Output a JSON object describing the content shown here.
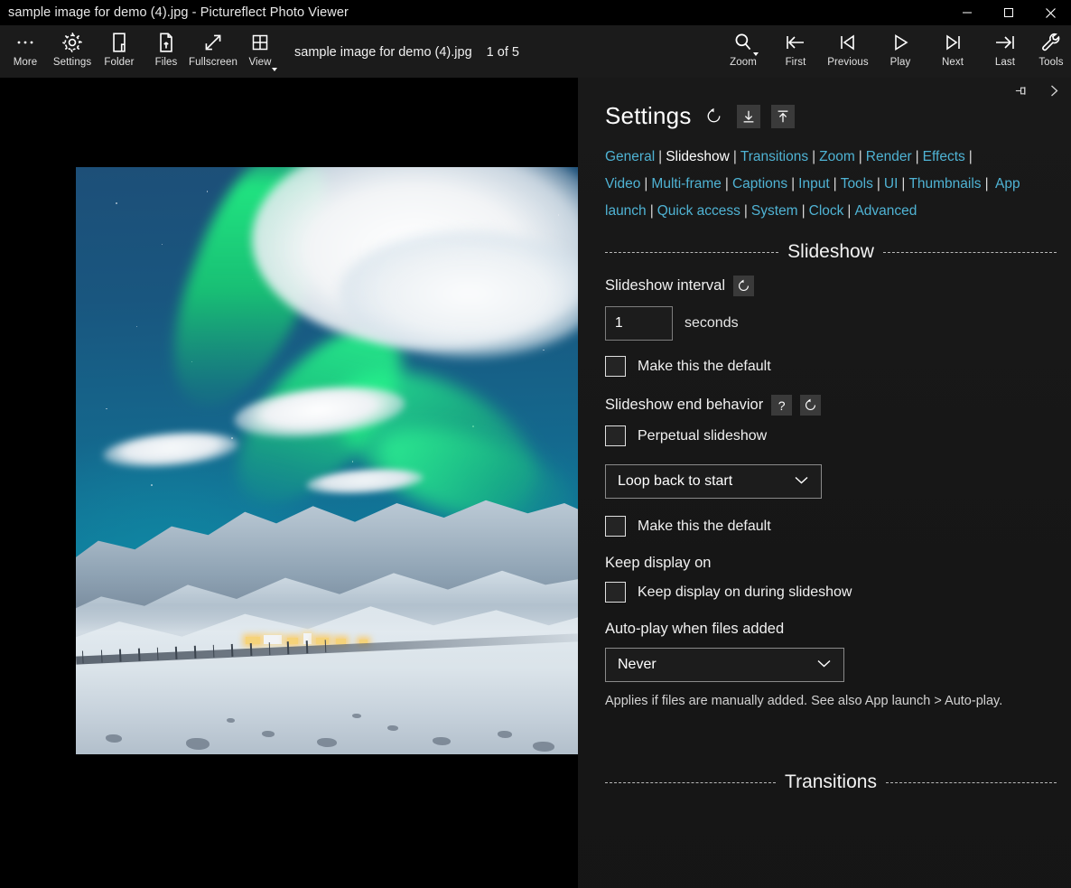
{
  "window": {
    "title": "sample image for demo (4).jpg - Pictureflect Photo Viewer",
    "controls": {
      "minimize": "minimize-icon",
      "maximize": "maximize-icon",
      "close": "close-icon"
    }
  },
  "toolbar": {
    "left_items": [
      {
        "label": "More",
        "icon": "ellipsis-icon",
        "caret": false
      },
      {
        "label": "Settings",
        "icon": "gear-icon",
        "caret": false
      },
      {
        "label": "Folder",
        "icon": "folder-icon",
        "caret": false
      },
      {
        "label": "Files",
        "icon": "files-icon",
        "caret": false
      },
      {
        "label": "Fullscreen",
        "icon": "fullscreen-icon",
        "caret": false
      },
      {
        "label": "View",
        "icon": "grid-view-icon",
        "caret": true
      }
    ],
    "filename": "sample image for demo (4).jpg",
    "counter": "1 of 5",
    "right_items": [
      {
        "label": "Zoom",
        "icon": "magnifier-icon",
        "caret": true
      },
      {
        "label": "First",
        "icon": "skip-first-icon",
        "caret": false
      },
      {
        "label": "Previous",
        "icon": "previous-icon",
        "caret": false
      },
      {
        "label": "Play",
        "icon": "play-icon",
        "caret": false
      },
      {
        "label": "Next",
        "icon": "next-icon",
        "caret": false
      },
      {
        "label": "Last",
        "icon": "skip-last-icon",
        "caret": false
      },
      {
        "label": "Tools",
        "icon": "wrench-icon",
        "caret": false
      }
    ]
  },
  "panel": {
    "top_buttons": [
      {
        "name": "pin-icon"
      },
      {
        "name": "chevron-right-icon"
      }
    ],
    "title": "Settings",
    "head_buttons": [
      {
        "name": "reset-icon",
        "glyph": "reset"
      },
      {
        "name": "import-icon",
        "glyph": "import"
      },
      {
        "name": "export-icon",
        "glyph": "export"
      }
    ],
    "nav_links": [
      "General",
      "Slideshow",
      "Transitions",
      "Zoom",
      "Render",
      "Effects",
      "Video",
      "Multi-frame",
      "Captions",
      "Input",
      "Tools",
      "UI",
      "Thumbnails",
      "App launch",
      "Quick access",
      "System",
      "Clock",
      "Advanced"
    ],
    "nav_active": "Slideshow",
    "sections": {
      "slideshow_header": "Slideshow",
      "transitions_header": "Transitions"
    },
    "interval": {
      "label": "Slideshow interval",
      "value": "1",
      "unit": "seconds",
      "default_checkbox": "Make this the default",
      "default_checked": false
    },
    "end_behavior": {
      "label": "Slideshow end behavior",
      "perpetual_checkbox": "Perpetual slideshow",
      "perpetual_checked": false,
      "select_value": "Loop back to start",
      "default_checkbox": "Make this the default",
      "default_checked": false
    },
    "keep_display": {
      "label": "Keep display on",
      "checkbox": "Keep display on during slideshow",
      "checked": false
    },
    "autoplay": {
      "label": "Auto-play when files added",
      "select_value": "Never",
      "hint": "Applies if files are manually added. See also App launch > Auto-play."
    }
  },
  "colors": {
    "accent_link": "#4fb3d4",
    "panel_bg": "#1a1a1a",
    "toolbar_bg": "#1b1b1b",
    "titlebar_bg": "#000000"
  }
}
